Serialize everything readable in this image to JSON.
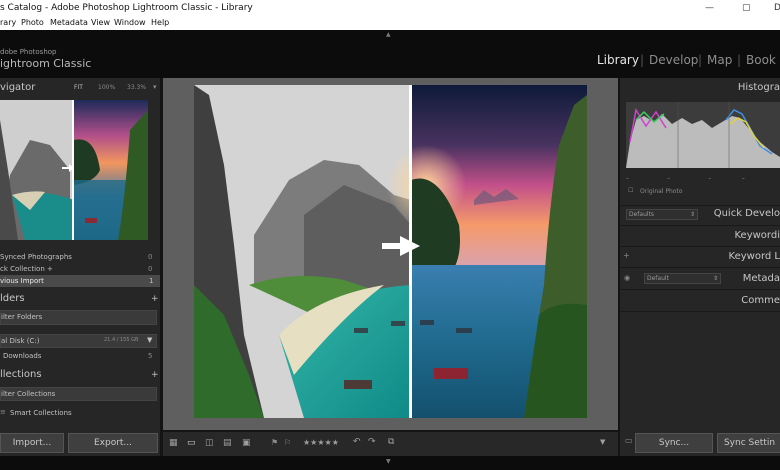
{
  "window": {
    "title": "s Catalog - Adobe Photoshop Lightroom Classic - Library",
    "minimize": "—",
    "maximize": "▢",
    "close": "D"
  },
  "menu": [
    "rary",
    "Photo",
    "Metadata",
    "View",
    "Window",
    "Help"
  ],
  "brand": {
    "line1": "dobe Photoshop",
    "line2": "ightroom Classic"
  },
  "modules": [
    "Library",
    "Develop",
    "Map",
    "Book"
  ],
  "navigator": {
    "title": "vigator",
    "zoom_options": [
      "FIT",
      "100%",
      "33.3%"
    ]
  },
  "catalog": [
    {
      "label": "Synced Photographs",
      "count": "0"
    },
    {
      "label": "ck Collection  +",
      "count": "0"
    },
    {
      "label": "vious Import",
      "count": "1"
    }
  ],
  "folders": {
    "title": "lders",
    "filter_placeholder": "ilter Folders",
    "disk_label": "al Disk (C:)",
    "disk_space": "21.4 / 155 GB",
    "downloads_label": "Downloads",
    "downloads_count": "5"
  },
  "collections": {
    "title": "llections",
    "filter_placeholder": "ilter Collections",
    "smart_label": "Smart Collections"
  },
  "left_buttons": {
    "import": "Import...",
    "export": "Export..."
  },
  "toolbar": {
    "rating": "★★★★★"
  },
  "histogram": {
    "title": "Histogra",
    "original_photo": "Original Photo"
  },
  "right_sections": {
    "quick_develop": "Quick Develo",
    "keywording": "Keywordi",
    "keyword_list": "Keyword L",
    "metadata": "Metada",
    "comments": "Comme",
    "preset_default": "Defaults",
    "metadata_default": "Default"
  },
  "right_buttons": {
    "sync": "Sync...",
    "sync_settings": "Sync Settin"
  },
  "colors": {
    "chrome_dark": "#0c0c0c",
    "panel": "#262626",
    "center_bg": "#5f5f5f",
    "active_module": "#e6e6e6",
    "inactive_module": "#8d8d8d"
  }
}
